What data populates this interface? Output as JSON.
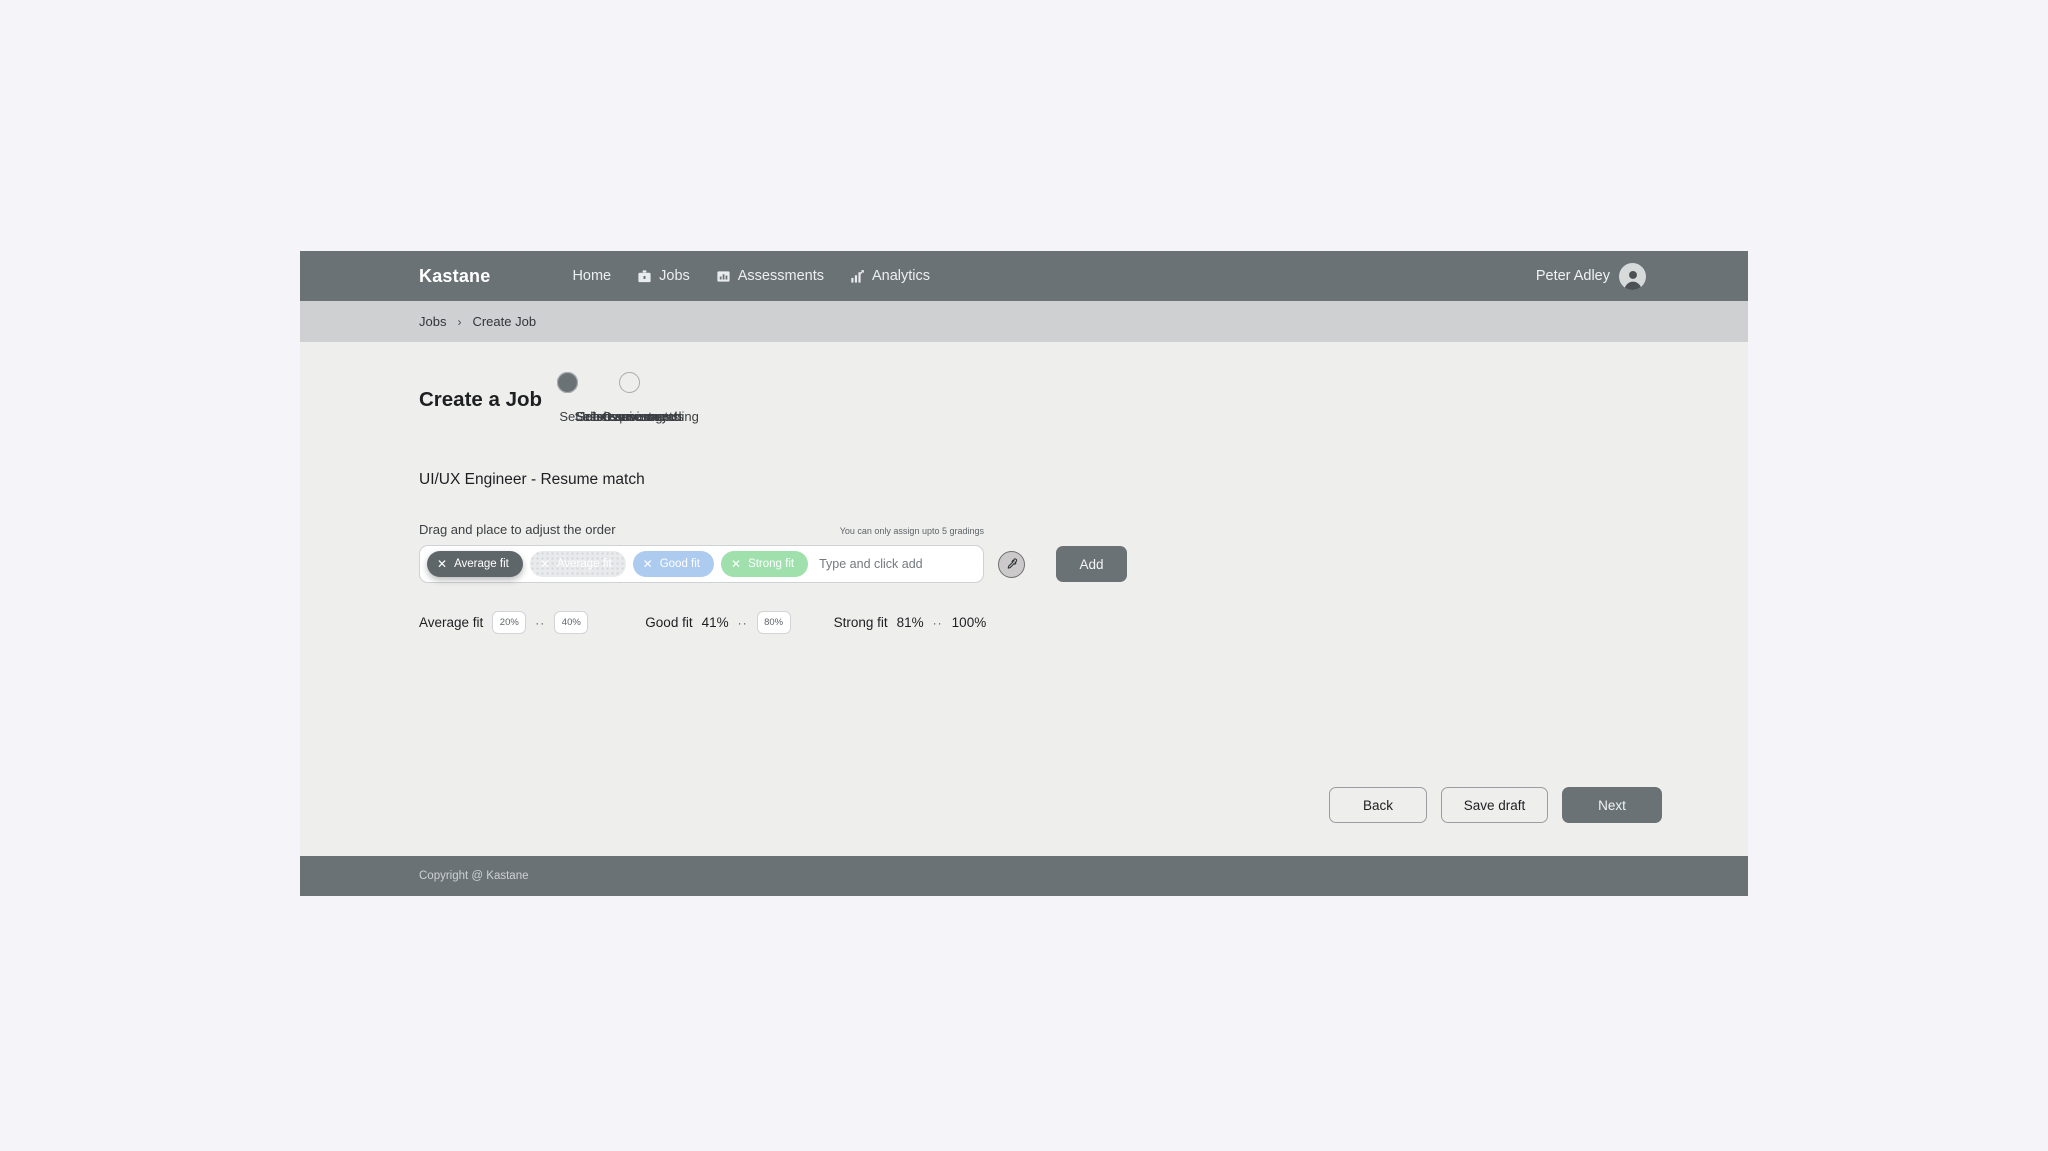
{
  "brand": "Kastane",
  "nav": [
    {
      "label": "Home",
      "icon": "none"
    },
    {
      "label": "Jobs",
      "icon": "briefcase-icon"
    },
    {
      "label": "Assessments",
      "icon": "assessment-chart-icon"
    },
    {
      "label": "Analytics",
      "icon": "analytics-icon"
    }
  ],
  "user": {
    "name": "Peter Adley",
    "avatar_icon": "user-avatar-icon"
  },
  "breadcrumb": {
    "parent": "Jobs",
    "separator": "›",
    "current": "Create Job"
  },
  "page": {
    "title": "Create a Job"
  },
  "stepper": {
    "steps": [
      {
        "label": "Overview",
        "state": "done"
      },
      {
        "label": "Job requirements",
        "state": "done"
      },
      {
        "label": "Set resume match",
        "state": "current"
      },
      {
        "label": "Select assesments",
        "state": "todo"
      },
      {
        "label": "Set assessment grading",
        "state": "todo"
      },
      {
        "label": "Job summary",
        "state": "todo"
      }
    ]
  },
  "section": {
    "title": "UI/UX Engineer - Resume match",
    "drag_hint": "Drag and place to adjust the order",
    "limit_hint": "You can only assign upto 5 gradings"
  },
  "chips": [
    {
      "label": "Average fit",
      "state": "dragging",
      "close_icon": "close-icon",
      "color": "#5f6669"
    },
    {
      "label": "Average fit",
      "state": "ghost",
      "close_icon": "close-icon",
      "color": "#e9eaec"
    },
    {
      "label": "Good fit",
      "state": "good",
      "close_icon": "close-icon",
      "color": "#adcbef"
    },
    {
      "label": "Strong fit",
      "state": "strong",
      "close_icon": "close-icon",
      "color": "#9fe0ad"
    }
  ],
  "chip_input": {
    "value": "",
    "placeholder": "Type and click add"
  },
  "eyedropper": {
    "icon": "eyedropper-icon"
  },
  "add_button": {
    "label": "Add"
  },
  "ranges": [
    {
      "label": "Average fit",
      "from": "20%",
      "from_editable": true,
      "dots": "··",
      "to": "40%",
      "to_editable": true
    },
    {
      "label": "Good fit",
      "from": "41%",
      "from_editable": false,
      "dots": "··",
      "to": "80%",
      "to_editable": true
    },
    {
      "label": "Strong fit",
      "from": "81%",
      "from_editable": false,
      "dots": "··",
      "to": "100%",
      "to_editable": false
    }
  ],
  "actions": {
    "back": "Back",
    "save_draft": "Save draft",
    "next": "Next"
  },
  "footer": {
    "copyright": "Copyright @ Kastane"
  }
}
